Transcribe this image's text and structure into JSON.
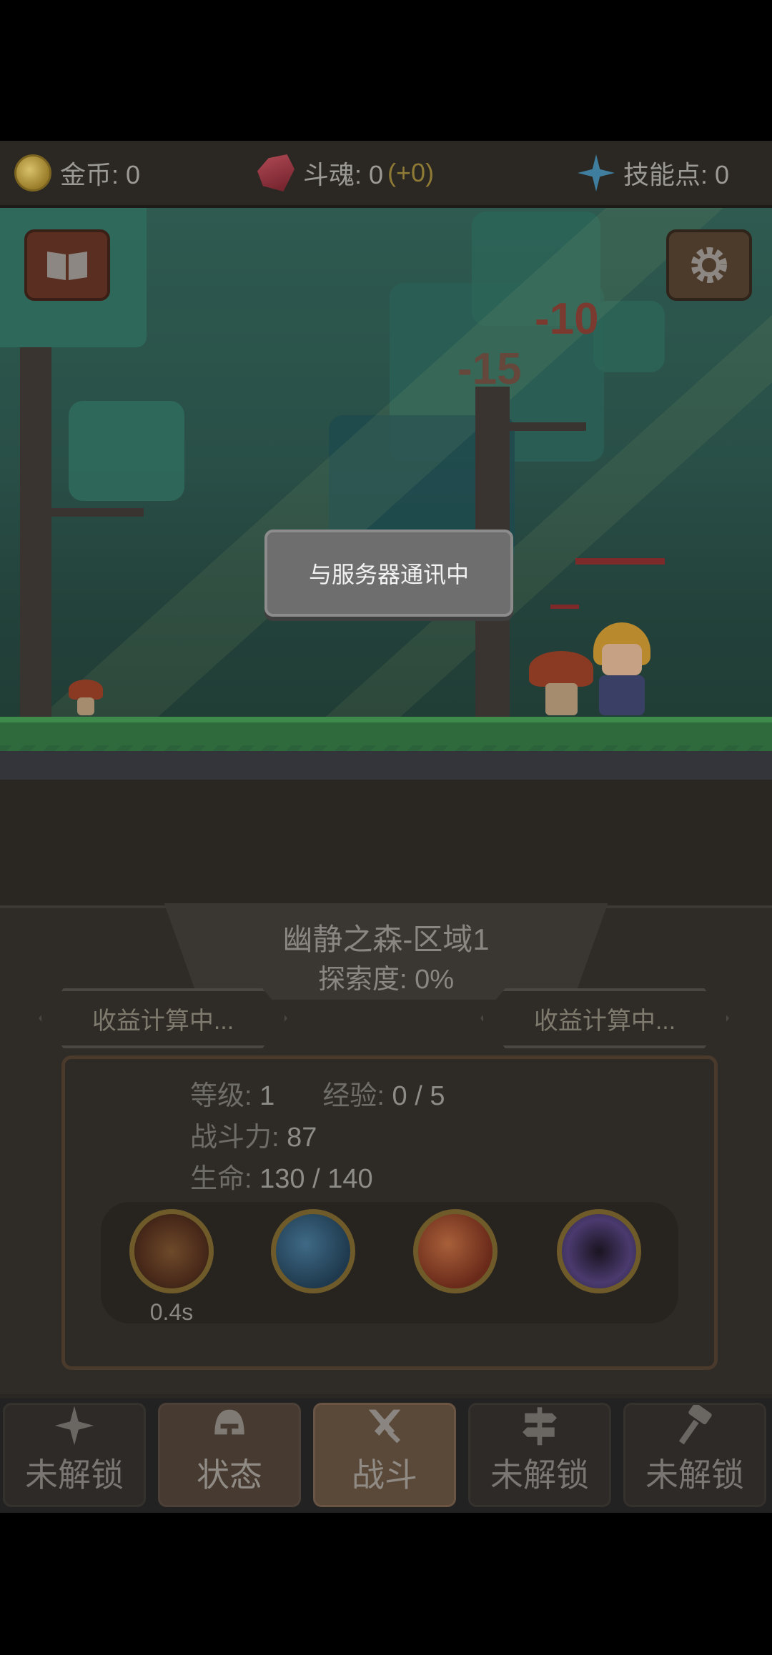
{
  "resources": {
    "gold": {
      "label": "金币: 0",
      "icon": "coin-icon"
    },
    "soul": {
      "label": "斗魂: 0",
      "bonus": "(+0)",
      "icon": "soul-crystal-icon"
    },
    "skill_points": {
      "label": "技能点: 0",
      "icon": "sparkle-icon"
    }
  },
  "scene": {
    "damage_numbers": [
      "-10",
      "-15"
    ]
  },
  "toast": {
    "text": "与服务器通讯中"
  },
  "zone": {
    "name": "幽静之森-区域1",
    "exploration": "探索度:  0%",
    "left_income": "收益计算中...",
    "right_income": "收益计算中..."
  },
  "stats": {
    "level_label": "等级: ",
    "level_value": "1",
    "exp_label": "经验: ",
    "exp_value": "0 / 5",
    "power_label": "战斗力: ",
    "power_value": "87",
    "hp_label": "生命: ",
    "hp_value": "130 / 140"
  },
  "skills": {
    "cooldown": "0.4s",
    "icons": [
      "fire-swirl-skill-icon",
      "wind-slash-skill-icon",
      "flame-burst-skill-icon",
      "void-vortex-skill-icon"
    ]
  },
  "nav": {
    "items": [
      {
        "label": "未解锁",
        "icon": "sparkle-icon"
      },
      {
        "label": "状态",
        "icon": "helmet-icon"
      },
      {
        "label": "战斗",
        "icon": "crossed-swords-icon"
      },
      {
        "label": "未解锁",
        "icon": "signpost-icon"
      },
      {
        "label": "未解锁",
        "icon": "hammer-icon"
      }
    ]
  },
  "colors": {
    "accent": "#8e7a35",
    "hp_bar": "#7d2a2a",
    "toast_bg": "#6e6e6e"
  }
}
